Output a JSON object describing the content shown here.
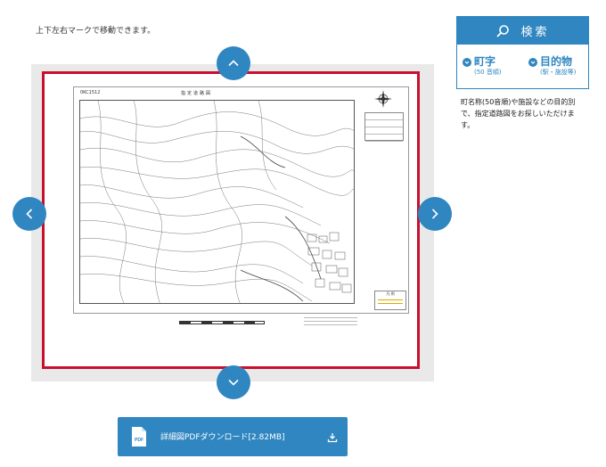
{
  "instruction": "上下左右マークで移動できます。",
  "map": {
    "code": "0KC1512",
    "title": "指定道路図",
    "legend_title": "凡 例"
  },
  "pdf_download": {
    "badge": "PDF",
    "label": "詳細図PDFダウンロード[2.82MB]"
  },
  "search": {
    "title": "検索",
    "options": [
      {
        "main": "町字",
        "sub": "(50 音順)"
      },
      {
        "main": "目的物",
        "sub": "(駅・施設等)"
      }
    ],
    "description": "町名称(50音順)や施設などの目的別で、指定道路図をお探しいただけます。"
  },
  "colors": {
    "accent": "#2f86c1",
    "frame": "#c8102e"
  }
}
